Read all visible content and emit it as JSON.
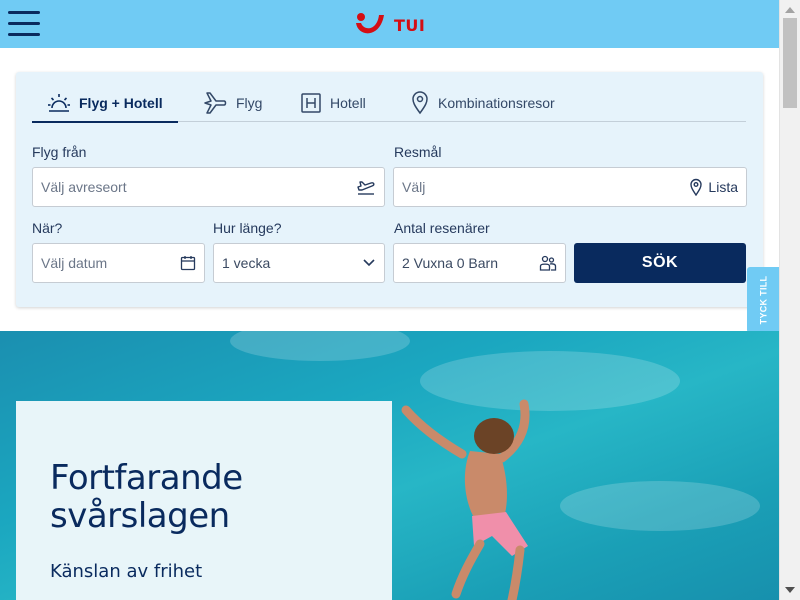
{
  "header": {
    "menu_icon": "hamburger-icon",
    "logo_text": "TUI",
    "brand_color": "#70cbf4",
    "logo_color": "#d40e14"
  },
  "search": {
    "tabs": [
      {
        "label": "Flyg + Hotell",
        "icon": "sun-icon",
        "active": true
      },
      {
        "label": "Flyg",
        "icon": "plane-icon",
        "active": false
      },
      {
        "label": "Hotell",
        "icon": "hotel-icon",
        "active": false
      },
      {
        "label": "Kombinationsresor",
        "icon": "location-pin-icon",
        "active": false
      }
    ],
    "from": {
      "label": "Flyg från",
      "placeholder": "Välj avreseort",
      "icon": "plane-departure-icon"
    },
    "destination": {
      "label": "Resmål",
      "placeholder": "Välj",
      "list_label": "Lista",
      "icon": "location-pin-icon"
    },
    "when": {
      "label": "När?",
      "placeholder": "Välj datum",
      "icon": "calendar-icon"
    },
    "duration": {
      "label": "Hur länge?",
      "value": "1 vecka",
      "icon": "chevron-down-icon"
    },
    "travellers": {
      "label": "Antal resenärer",
      "value": "2 Vuxna 0 Barn",
      "icon": "people-icon"
    },
    "search_button": "SÖK",
    "accent_color": "#092a5e"
  },
  "feedback": {
    "label": "TYCK TILL"
  },
  "hero": {
    "title": "Fortfarande svårslagen",
    "subtitle": "Känslan av frihet"
  }
}
